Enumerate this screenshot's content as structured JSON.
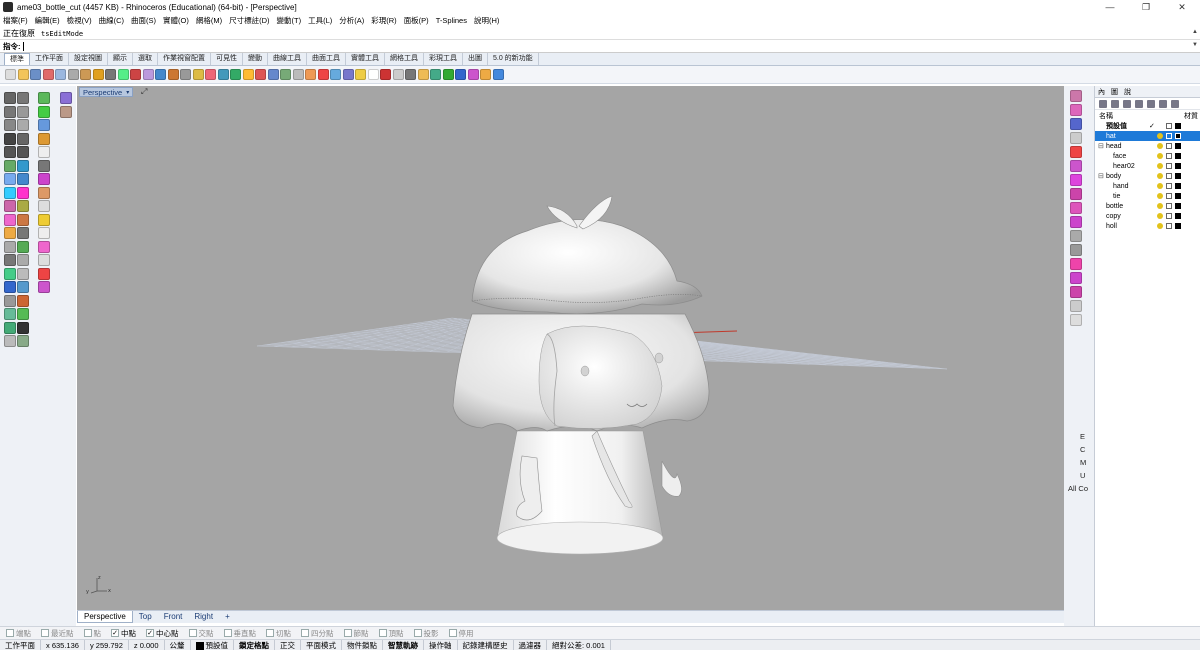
{
  "window": {
    "title": "ame03_bottle_cut (4457 KB) - Rhinoceros (Educational) (64-bit) - [Perspective]",
    "minimize": "—",
    "restore": "❐",
    "close": "✕"
  },
  "menu": [
    "檔案(F)",
    "編輯(E)",
    "檢視(V)",
    "曲線(C)",
    "曲面(S)",
    "實體(O)",
    "網格(M)",
    "尺寸標註(D)",
    "變動(T)",
    "工具(L)",
    "分析(A)",
    "彩現(R)",
    "面板(P)",
    "T-Splines",
    "說明(H)"
  ],
  "command": {
    "history_label": "正在復原",
    "history_value": "tsEditMode",
    "prompt_label": "指令:"
  },
  "toolbar_tabs": [
    "標準",
    "工作平面",
    "設定視圖",
    "顯示",
    "選取",
    "作業視窗配置",
    "可見性",
    "變動",
    "曲線工具",
    "曲面工具",
    "實體工具",
    "網格工具",
    "彩現工具",
    "出圖",
    "5.0 的新功能"
  ],
  "viewport": {
    "name": "Perspective",
    "menu_arrow": "▾",
    "tabs": [
      "Perspective",
      "Top",
      "Front",
      "Right"
    ],
    "add_tab": "+",
    "axis_x": "x",
    "axis_y": "y",
    "axis_z": "z"
  },
  "right_palette_labels": [
    "E",
    "C",
    "M",
    "U",
    "All Co"
  ],
  "layers": {
    "tabs": [
      "內",
      "圖",
      "說"
    ],
    "header_name": "名稱",
    "header_material": "材質",
    "rows": [
      {
        "name": "預設值",
        "indent": 1,
        "bold": true,
        "check": "✓",
        "selected": false,
        "bulb": false
      },
      {
        "name": "hat",
        "indent": 1,
        "bold": false,
        "check": "",
        "selected": true,
        "bulb": true
      },
      {
        "name": "head",
        "indent": 1,
        "bold": false,
        "check": "",
        "selected": false,
        "bulb": true,
        "expander": "⊟"
      },
      {
        "name": "face",
        "indent": 2,
        "bold": false,
        "check": "",
        "selected": false,
        "bulb": true
      },
      {
        "name": "hear02",
        "indent": 2,
        "bold": false,
        "check": "",
        "selected": false,
        "bulb": true
      },
      {
        "name": "body",
        "indent": 1,
        "bold": false,
        "check": "",
        "selected": false,
        "bulb": true,
        "expander": "⊟"
      },
      {
        "name": "hand",
        "indent": 2,
        "bold": false,
        "check": "",
        "selected": false,
        "bulb": true
      },
      {
        "name": "tie",
        "indent": 2,
        "bold": false,
        "check": "",
        "selected": false,
        "bulb": true
      },
      {
        "name": "bottle",
        "indent": 1,
        "bold": false,
        "check": "",
        "selected": false,
        "bulb": true
      },
      {
        "name": "copy",
        "indent": 1,
        "bold": false,
        "check": "",
        "selected": false,
        "bulb": true
      },
      {
        "name": "holl",
        "indent": 1,
        "bold": false,
        "check": "",
        "selected": false,
        "bulb": true
      }
    ]
  },
  "osnaps": [
    {
      "label": "端點",
      "on": false
    },
    {
      "label": "最近點",
      "on": false
    },
    {
      "label": "點",
      "on": false
    },
    {
      "label": "中點",
      "on": true
    },
    {
      "label": "中心點",
      "on": true
    },
    {
      "label": "交點",
      "on": false
    },
    {
      "label": "垂直點",
      "on": false
    },
    {
      "label": "切點",
      "on": false
    },
    {
      "label": "四分點",
      "on": false
    },
    {
      "label": "節點",
      "on": false
    },
    {
      "label": "頂點",
      "on": false
    },
    {
      "label": "投影",
      "on": false
    },
    {
      "label": "停用",
      "on": false
    }
  ],
  "status": {
    "cplane": "工作平面",
    "x": "x 635.136",
    "y": "y 259.792",
    "z": "z 0.000",
    "units": "公釐",
    "layer": "預設值",
    "toggles": [
      "鎖定格點",
      "正交",
      "平面模式",
      "物件鎖點",
      "智慧軌跡",
      "操作軸",
      "記錄建構歷史",
      "過濾器",
      "絕對公差: 0.001"
    ]
  },
  "colors": {
    "viewport_bg": "#a5a5a5",
    "selected_row": "#1e7ad8",
    "grid_line": "#c4cad6",
    "axis_red": "#c0392b"
  }
}
